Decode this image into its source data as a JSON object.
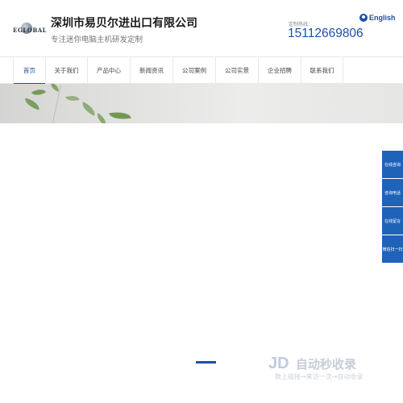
{
  "header": {
    "logo_text": "EGLOBAL",
    "company_name": "深圳市易贝尔进出口有限公司",
    "slogan": "专注迷你电脑主机研发定制",
    "hotline_label": "定制热线：",
    "hotline_number": "15112669806",
    "lang_label": "English"
  },
  "nav": {
    "items": [
      {
        "label": "首页",
        "active": true
      },
      {
        "label": "关于我们"
      },
      {
        "label": "产品中心"
      },
      {
        "label": "新闻资讯"
      },
      {
        "label": "公司案例"
      },
      {
        "label": "公司实景"
      },
      {
        "label": "企业招聘"
      },
      {
        "label": "联系我们"
      }
    ]
  },
  "sidebar": {
    "buttons": [
      "在线咨询",
      "咨询电话",
      "在线留言",
      "微信扫一扫"
    ]
  },
  "watermark": {
    "logo": "JD",
    "title": "自动秒收录",
    "subtitle": "数上链接→来访一次→自动收录"
  },
  "colors": {
    "brand_blue": "#1e4fa3",
    "sidebar_blue": "#1e63b8"
  }
}
